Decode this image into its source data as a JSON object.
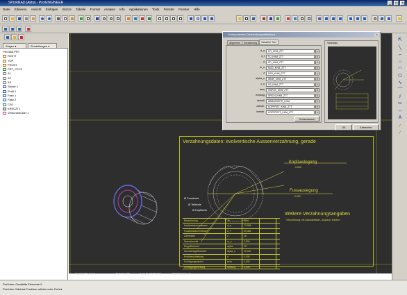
{
  "window": {
    "title": "SPURRAD [Aktiv] - Pro/ENGINEER"
  },
  "menu": [
    "Datei",
    "Editieren",
    "Ansicht",
    "Einfügen",
    "Skizze",
    "Tabelle",
    "Format",
    "Analyse",
    "Info",
    "Applikationen",
    "Tools",
    "Fenster",
    "Fenster",
    "Hilfe"
  ],
  "navigator": {
    "tabs": [
      "Zeigen",
      "Einstellungen"
    ],
    "root": "PEG666.PRT",
    "items": [
      "RIGHT",
      "TOP",
      "FRONT",
      "PRT_CSYS",
      "A1",
      "A2",
      "A3",
      "Skizze 1",
      "Profil 1",
      "Fase 1",
      "Fase 2",
      "CS0",
      "KREUZT1",
      "Verbundmuster 1"
    ]
  },
  "dialog": {
    "title": "Komponenten (Verbindungsdefinition)",
    "tabs": [
      "Allgemein",
      "Verzahnung",
      "Variabler Text"
    ],
    "rows": [
      {
        "label": "d_a",
        "value": "KO_KHM_ZTT"
      },
      {
        "label": "d_f",
        "value": "FU_KHM_ZTT"
      },
      {
        "label": "d",
        "value": "KD_KHM_ZTT"
      },
      {
        "label": "m_n",
        "value": "MOD_KHM_ZTT"
      },
      {
        "label": "z",
        "value": "NZH_KHM_ZTT"
      },
      {
        "label": "alpha_n",
        "value": "WINK_KHM_ZTT"
      },
      {
        "label": "x_n",
        "value": "KS_KHM_ZTT"
      },
      {
        "label": "beta",
        "value": "SWFAK_KHM_ZTT"
      },
      {
        "label": "richtung",
        "value": "SRICH_KHM_ZTT"
      },
      {
        "label": "abmaß",
        "value": "ABMAßSEITE_KHM"
      },
      {
        "label": "zahnbr.",
        "value": "KOPFPIST_KHM_ZTT"
      },
      {
        "label": "kreisbr.",
        "value": "KOPFPIST2_KHM_ZTT"
      }
    ],
    "default_button": "Textaustausch",
    "preview_label": "Vorschau",
    "ok": "OK",
    "cancel": "Abbrechen"
  },
  "drawing": {
    "title": "Verzahnungsdaten: evolventische Aussenverzahnung, gerade",
    "kopf_label": "Kopfauslegung",
    "kopf_value": "0,300",
    "fuss_label": "Fussauslegung",
    "fuss_value": "0,300",
    "kreise": [
      "Ø Fusskreis",
      "Ø Teilkreis",
      "Ø Kopfkreis"
    ],
    "weitere_title": "Weitere Verzahnungsangaben",
    "weitere_sub": "Verzahnung mit Abwalzfräser, Auslauf, Kanten",
    "table": [
      [
        "Bezeichnung",
        "Z/I",
        "Wert",
        ""
      ],
      [
        "Kopfkreisdurchmesser",
        "d_a",
        "73,998",
        ""
      ],
      [
        "Fusskreisdurchmesser",
        "d_f",
        "59,385",
        ""
      ],
      [
        "Zähnezahl",
        "z",
        "18",
        ""
      ],
      [
        "Normalmodul",
        "m_n",
        "3,500",
        ""
      ],
      [
        "Eingriffswinkel",
        "alpha",
        "20°",
        ""
      ],
      [
        "Normaleingriffswinkel",
        "alpha_n",
        "20,000",
        ""
      ],
      [
        "Profilverschiebung",
        "x",
        "0,000",
        ""
      ],
      [
        "Schrägungswinkel",
        "beta",
        "0,000",
        ""
      ],
      [
        "Schrägungsrichtung",
        "richtung",
        "0,000",
        ""
      ]
    ],
    "status_row": [
      "MASSSTAB 2:1",
      "TYP PART",
      "NAME PET0001",
      "GROESSE A2"
    ]
  },
  "statusbar": {
    "line1": "Pro/Infos: Gewählte Elemente 0",
    "line2": "Pro/Infos: Nächste Funktion wählen oder Zurück"
  },
  "colors": {
    "drawing_line": "#d8d840",
    "gear_wire": "#c8c8d8",
    "graphics_bg": "#2e2e2e"
  }
}
